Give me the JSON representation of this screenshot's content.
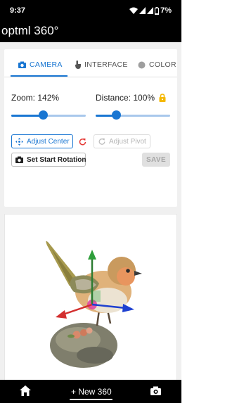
{
  "status_bar": {
    "time": "9:37",
    "icons": [
      "photo-icon",
      "wifi-icon",
      "signal-icon",
      "signal-icon",
      "battery-icon"
    ],
    "battery": "7%"
  },
  "app_bar": {
    "title": "optml 360°"
  },
  "tabs": [
    {
      "label": "CAMERA",
      "icon": "camera-icon",
      "selected": true
    },
    {
      "label": "INTERFACE",
      "icon": "touch-icon",
      "selected": false
    },
    {
      "label": "COLOR",
      "icon": "circle-icon",
      "selected": false
    }
  ],
  "controls": {
    "zoom": {
      "label": "Zoom: 142%",
      "position": 0.42
    },
    "distance": {
      "label": "Distance: 100%",
      "position": 0.27,
      "locked": true
    },
    "adjust_center": "Adjust Center",
    "adjust_pivot": "Adjust Pivot",
    "set_start_rotation": "Set Start Rotation",
    "save": "SAVE"
  },
  "colors": {
    "accent": "#1976d2",
    "lock": "#f5b800",
    "reset": "#e53935",
    "axis_x": "#d32f2f",
    "axis_y": "#2e7d32",
    "axis_z": "#1e40d0"
  },
  "viewer": {
    "subject": "bird figurine on rock",
    "gizmo": true
  },
  "bottom_nav": {
    "home_icon": "home-icon",
    "new_label": "+ New 360",
    "camera_icon": "camera-icon"
  }
}
